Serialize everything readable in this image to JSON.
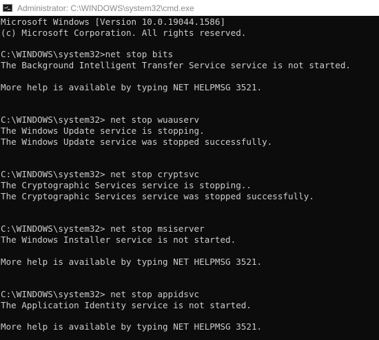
{
  "window": {
    "title": "Administrator: C:\\WINDOWS\\system32\\cmd.exe",
    "icon": "cmd-icon",
    "colors": {
      "titlebar_bg": "#ffffff",
      "title_text": "#8a8a8a",
      "console_bg": "#0c0c0c",
      "console_text": "#cccccc"
    }
  },
  "console": {
    "lines": [
      "Microsoft Windows [Version 10.0.19044.1586]",
      "(c) Microsoft Corporation. All rights reserved.",
      "",
      "C:\\WINDOWS\\system32>net stop bits",
      "The Background Intelligent Transfer Service service is not started.",
      "",
      "More help is available by typing NET HELPMSG 3521.",
      "",
      "",
      "C:\\WINDOWS\\system32> net stop wuauserv",
      "The Windows Update service is stopping.",
      "The Windows Update service was stopped successfully.",
      "",
      "",
      "C:\\WINDOWS\\system32> net stop cryptsvc",
      "The Cryptographic Services service is stopping..",
      "The Cryptographic Services service was stopped successfully.",
      "",
      "",
      "C:\\WINDOWS\\system32> net stop msiserver",
      "The Windows Installer service is not started.",
      "",
      "More help is available by typing NET HELPMSG 3521.",
      "",
      "",
      "C:\\WINDOWS\\system32> net stop appidsvc",
      "The Application Identity service is not started.",
      "",
      "More help is available by typing NET HELPMSG 3521."
    ]
  }
}
